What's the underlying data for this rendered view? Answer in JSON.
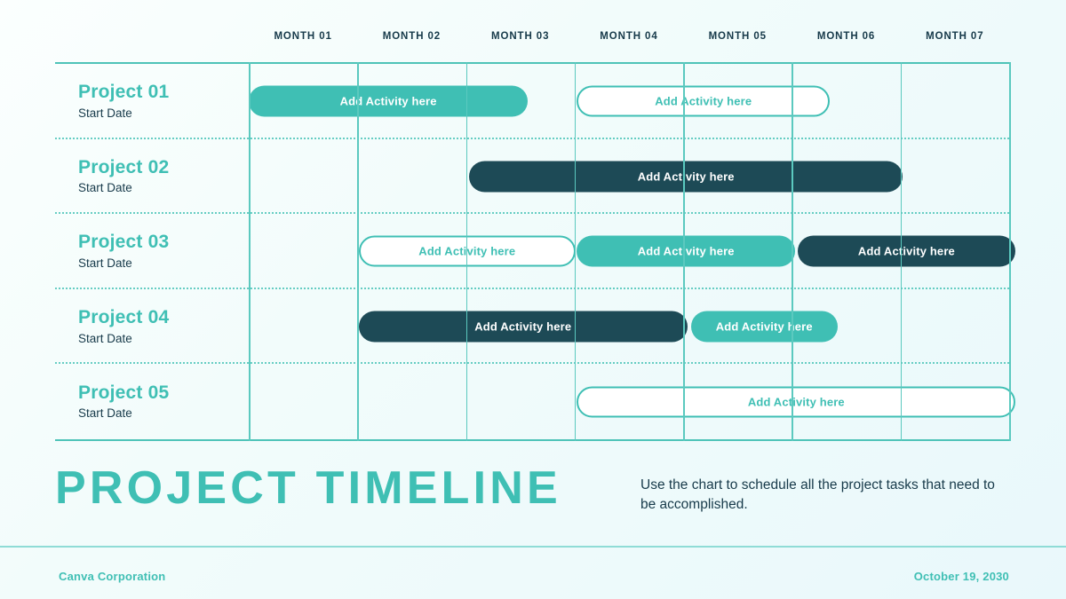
{
  "chart_data": {
    "type": "bar",
    "title": "PROJECT TIMELINE",
    "subtitle": "Use the chart to schedule all the project tasks that need to be accomplished.",
    "xlabel": "",
    "ylabel": "",
    "grid": true,
    "legend": false,
    "categories": [
      "MONTH 01",
      "MONTH 02",
      "MONTH 03",
      "MONTH 04",
      "MONTH 05",
      "MONTH 06",
      "MONTH 07"
    ],
    "xlim": [
      0,
      7
    ],
    "rows": [
      {
        "label": "Project 01",
        "sublabel": "Start Date",
        "tasks": [
          {
            "text": "Add Activity here",
            "style": "solid",
            "start": 0.0,
            "end": 2.57
          },
          {
            "text": "Add Activity here",
            "style": "outline",
            "start": 3.02,
            "end": 5.35
          }
        ]
      },
      {
        "label": "Project 02",
        "sublabel": "Start Date",
        "tasks": [
          {
            "text": "Add Activity here",
            "style": "dark",
            "start": 2.03,
            "end": 6.02
          }
        ]
      },
      {
        "label": "Project 03",
        "sublabel": "Start Date",
        "tasks": [
          {
            "text": "Add Activity here",
            "style": "outline",
            "start": 1.01,
            "end": 3.01
          },
          {
            "text": "Add Activity here",
            "style": "solid",
            "start": 3.02,
            "end": 5.03
          },
          {
            "text": "Add Activity here",
            "style": "dark",
            "start": 5.05,
            "end": 7.06
          }
        ]
      },
      {
        "label": "Project 04",
        "sublabel": "Start Date",
        "tasks": [
          {
            "text": "Add Activity here",
            "style": "dark",
            "start": 1.01,
            "end": 4.04
          },
          {
            "text": "Add Activity here",
            "style": "solid",
            "start": 4.07,
            "end": 5.42
          }
        ]
      },
      {
        "label": "Project 05",
        "sublabel": "Start Date",
        "tasks": [
          {
            "text": "Add Activity here",
            "style": "outline",
            "start": 3.02,
            "end": 7.06
          }
        ]
      }
    ]
  },
  "header": {
    "months": [
      "MONTH 01",
      "MONTH 02",
      "MONTH 03",
      "MONTH 04",
      "MONTH 05",
      "MONTH 06",
      "MONTH 07"
    ]
  },
  "title_block": {
    "title": "PROJECT TIMELINE",
    "description": "Use the chart to schedule all the project tasks that need to be accomplished."
  },
  "footer": {
    "company": "Canva Corporation",
    "date": "October 19, 2030"
  },
  "colors": {
    "teal": "#3fbfb4",
    "navy": "#1d4a56",
    "grid": "#5bc9bf",
    "text_dark": "#173a4a",
    "bg_start": "#fbfffe",
    "bg_end": "#e9f8fb"
  }
}
